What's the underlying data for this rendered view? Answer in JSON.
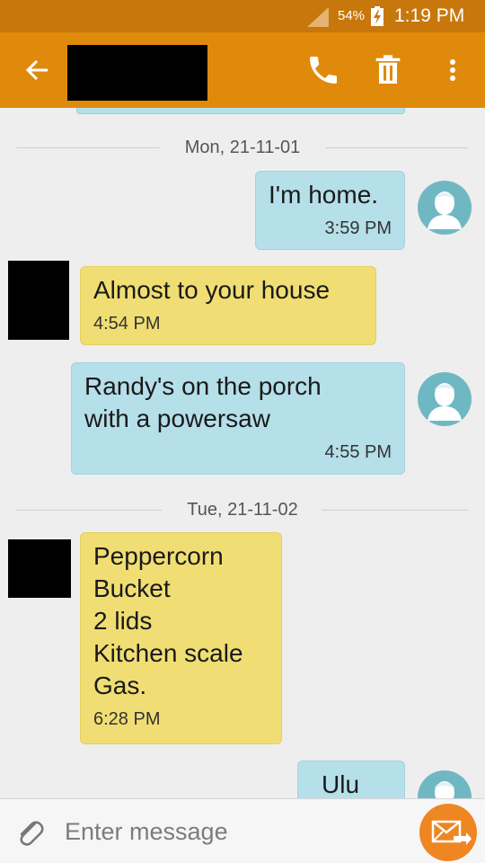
{
  "status_bar": {
    "battery": "54%",
    "time": "1:19 PM"
  },
  "thread": {
    "date_separators": [
      "Mon, 21-11-01",
      "Tue, 21-11-02"
    ],
    "messages": [
      {
        "direction": "sent",
        "text": "I'm home.",
        "time": "3:59 PM"
      },
      {
        "direction": "received",
        "text": "Almost to your house",
        "time": "4:54 PM"
      },
      {
        "direction": "sent",
        "text": "Randy's on the porch\nwith a powersaw",
        "time": "4:55 PM"
      },
      {
        "direction": "received",
        "text": "Peppercorn\nBucket\n2 lids\nKitchen scale\nGas.",
        "time": "6:28 PM"
      },
      {
        "direction": "sent",
        "text": "Ulu",
        "time": ""
      }
    ]
  },
  "compose": {
    "placeholder": "Enter message"
  },
  "colors": {
    "status_bar": "#c8770c",
    "app_bar": "#e08a0c",
    "sent_bubble": "#b5dfe9",
    "received_bubble": "#f0de74",
    "send_button": "#ee8622"
  },
  "icons": [
    "back-arrow-icon",
    "phone-icon",
    "trash-icon",
    "more-vert-icon",
    "paperclip-icon",
    "send-mail-icon",
    "person-avatar-icon"
  ]
}
